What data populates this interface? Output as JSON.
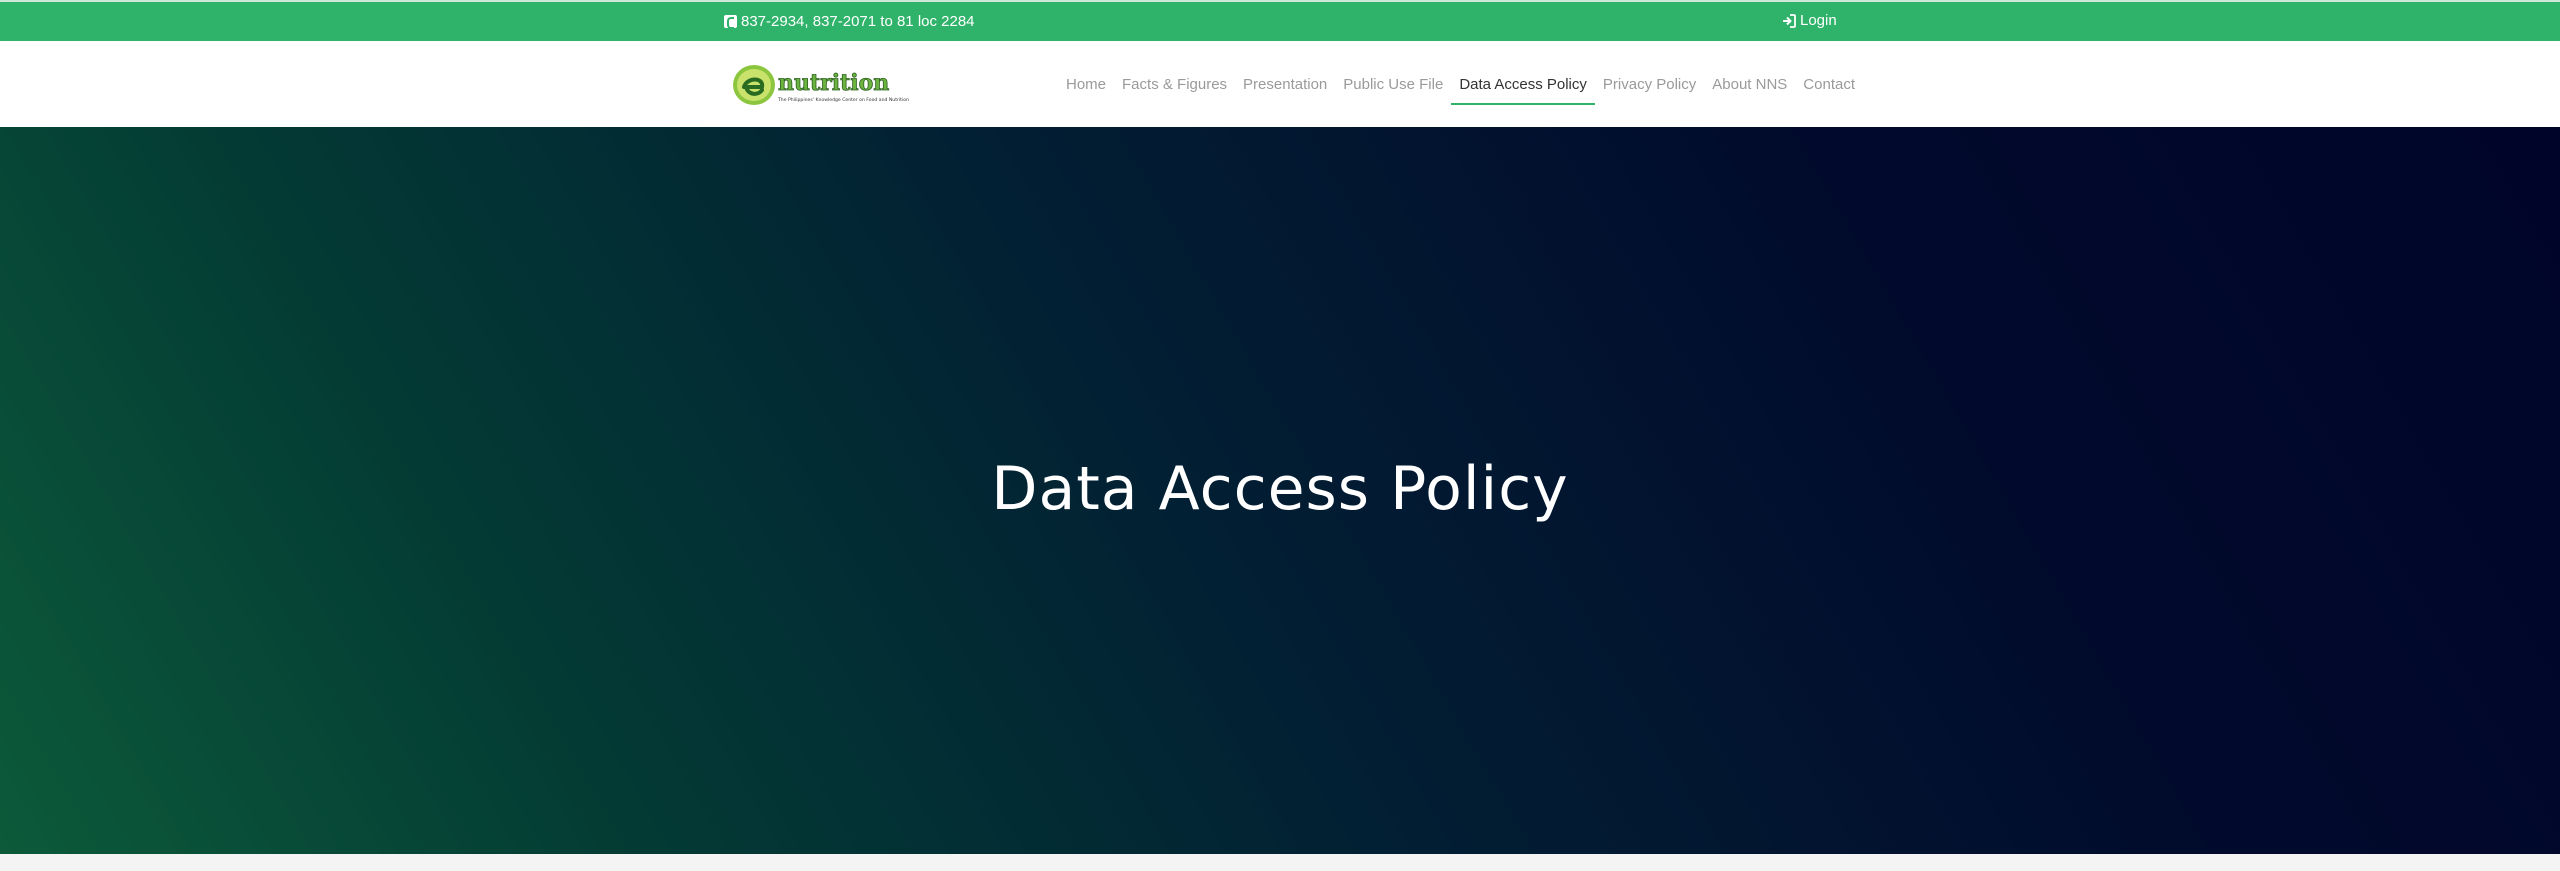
{
  "topbar": {
    "phone": "837-2934, 837-2071 to 81 loc 2284",
    "login": "Login"
  },
  "logo": {
    "text": "nutrition",
    "tagline": "The Philippines' Knowledge Center on Food and Nutrition"
  },
  "nav": {
    "items": [
      {
        "label": "Home"
      },
      {
        "label": "Facts & Figures"
      },
      {
        "label": "Presentation"
      },
      {
        "label": "Public Use File"
      },
      {
        "label": "Data Access Policy"
      },
      {
        "label": "Privacy Policy"
      },
      {
        "label": "About NNS"
      },
      {
        "label": "Contact"
      }
    ],
    "active_index": 4
  },
  "hero": {
    "title": "Data Access Policy"
  },
  "colors": {
    "brand_green": "#2fb36a",
    "hero_start": "#0c5a3a",
    "hero_end": "#000429"
  }
}
